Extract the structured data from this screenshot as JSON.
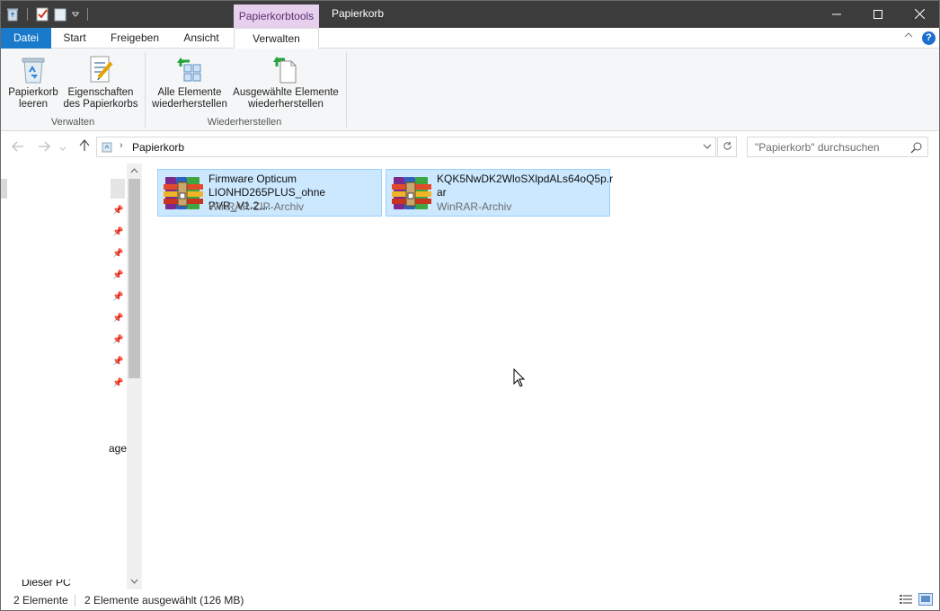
{
  "titlebar": {
    "context_tab": "Papierkorbtools",
    "title": "Papierkorb",
    "minimize_glyph": "—",
    "maximize_glyph": "☐",
    "close_glyph": "✕"
  },
  "ribbon_tabs": {
    "file": "Datei",
    "start": "Start",
    "share": "Freigeben",
    "view": "Ansicht",
    "manage": "Verwalten",
    "help_glyph": "?"
  },
  "ribbon": {
    "empty_bin_line1": "Papierkorb",
    "empty_bin_line2": "leeren",
    "props_line1": "Eigenschaften",
    "props_line2": "des Papierkorbs",
    "group_manage": "Verwalten",
    "restore_all_line1": "Alle Elemente",
    "restore_all_line2": "wiederherstellen",
    "restore_sel_line1": "Ausgewählte Elemente",
    "restore_sel_line2": "wiederherstellen",
    "group_restore": "Wiederherstellen"
  },
  "address": {
    "path": "Papierkorb",
    "search_placeholder": "\"Papierkorb\" durchsuchen"
  },
  "navpane": {
    "partial_label": "age",
    "bottom_label": "Dieser PC"
  },
  "files": [
    {
      "name_line1": "Firmware Opticum",
      "name_line2": "LIONHD265PLUS_ohne PVR_V1.2....",
      "type": "WinRAR-ZIP-Archiv"
    },
    {
      "name_line1": "KQK5NwDK2WloSXlpdALs64oQ5p.r",
      "name_line2": "ar",
      "type": "WinRAR-Archiv"
    }
  ],
  "status": {
    "count": "2 Elemente",
    "selected": "2 Elemente ausgewählt (126 MB)"
  },
  "colors": {
    "titlebar": "#3c3c3c",
    "context_tab": "#e6d0ee",
    "file_tab": "#1979ca",
    "selection": "#cce8ff",
    "selection_border": "#99d1ff"
  },
  "icons": {
    "recycle_bin": "recycle-bin-icon",
    "properties": "properties-icon",
    "restore_all": "restore-all-icon",
    "restore_selected": "restore-selected-icon",
    "winrar": "winrar-archive-icon"
  }
}
